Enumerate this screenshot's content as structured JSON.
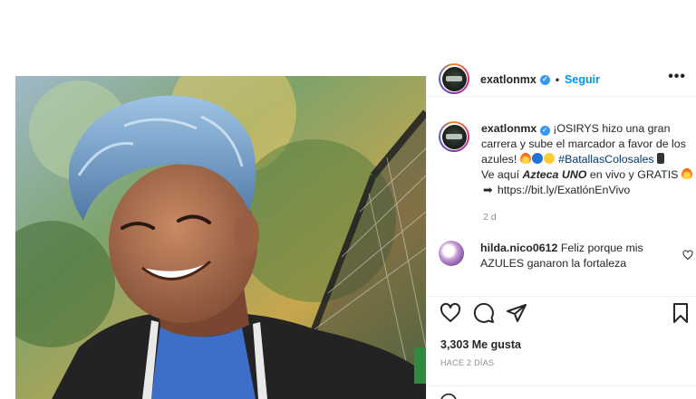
{
  "post": {
    "username": "exatlonmx",
    "follow_label": "Seguir",
    "more_label": "•••",
    "caption": {
      "username": "exatlonmx",
      "line1": "¡OSIRYS hizo una gran carrera y sube el marcador a favor de los azules!",
      "hashtag": "#BatallasColosales",
      "line2_prefix": "Ve aquí",
      "channel": "Azteca UNO",
      "line2_suffix": "en vivo y GRATIS",
      "link_arrow": "➡",
      "link": "https://bit.ly/ExatlónEnVivo"
    },
    "timestamp": "2 d",
    "comment": {
      "username": "hilda.nico0612",
      "text": "Feliz porque mis AZULES ganaron la fortaleza"
    },
    "likes": "3,303 Me gusta",
    "posted_ago": "HACE 2 DÍAS"
  },
  "colors": {
    "accent": "#0095f6",
    "verified": "#3897f0",
    "muted": "#8e8e8e",
    "text": "#262626"
  },
  "icons": {
    "like": "heart-icon",
    "comment": "comment-icon",
    "share": "paper-plane-icon",
    "save": "bookmark-icon",
    "options": "more-icon",
    "verified": "verified-badge-icon"
  }
}
